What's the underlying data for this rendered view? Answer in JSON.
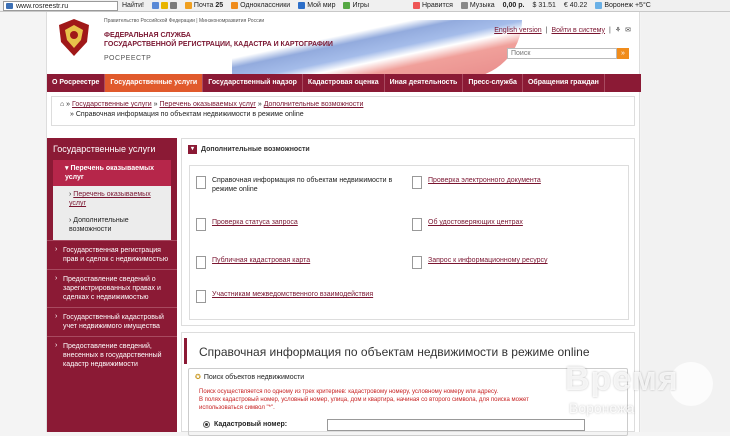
{
  "toolbar": {
    "url": "www.rosreestr.ru",
    "find": "Найти!",
    "items": [
      "Почта",
      "25",
      "Одноклассники",
      "Мой мир",
      "Игры",
      "Нравится",
      "Музыка",
      "0,00 р.",
      "31.51",
      "40.22",
      "Воронеж +5°C"
    ]
  },
  "header": {
    "govt": "Правительство Российской Федерации | Минэкономразвития России",
    "title_line1": "ФЕДЕРАЛЬНАЯ СЛУЖБА",
    "title_line2": "ГОСУДАРСТВЕННОЙ РЕГИСТРАЦИИ, КАДАСТРА И КАРТОГРАФИИ",
    "brand": "РОСРЕЕСТР",
    "english": "English version",
    "login": "Войти в систему",
    "search_placeholder": "Поиск"
  },
  "nav": [
    "О Росреестре",
    "Государственные услуги",
    "Государственный надзор",
    "Кадастровая оценка",
    "Иная деятельность",
    "Пресс-служба",
    "Обращения граждан"
  ],
  "breadcrumb": {
    "l1": "Государственные услуги",
    "l2": "Перечень оказываемых услуг",
    "l3": "Дополнительные возможности",
    "current": "Справочная информация по объектам недвижимости в режиме online"
  },
  "sidebar": {
    "title": "Государственные услуги",
    "section": "Перечень оказываемых услуг",
    "sub1": "Перечень оказываемых услуг",
    "sub2": "Дополнительные возможности",
    "items": [
      "Государственная регистрация прав и сделок с недвижимостью",
      "Предоставление сведений о зарегистрированных правах и сделках с недвижимостью",
      "Государственный кадастровый учет недвижимого имущества",
      "Предоставление сведений, внесенных в государственный кадастр недвижимости"
    ]
  },
  "extras": {
    "title": "Дополнительные возможности",
    "links": [
      "Справочная информация по объектам недвижимости в режиме online",
      "Проверка электронного документа",
      "Проверка статуса запроса",
      "Об удостоверяющих центрах",
      "Публичная кадастровая карта",
      "Запрос к информационному ресурсу",
      "Участникам межведомственного взаимодействия"
    ]
  },
  "main": {
    "heading": "Справочная информация по объектам недвижимости в режиме online",
    "form_legend": "Поиск объектов недвижимости",
    "hint1": "Поиск осуществляется по одному из трех критериев: кадастровому номеру, условному номеру или адресу.",
    "hint2": "В полях кадастровый номер, условный номер, улица, дом и квартира, начиная со второго символа, для поиска может использоваться символ \"*\".",
    "cad_label": "Кадастровый номер:"
  },
  "watermark": {
    "t1": "Время",
    "t2": "Воронежа"
  }
}
